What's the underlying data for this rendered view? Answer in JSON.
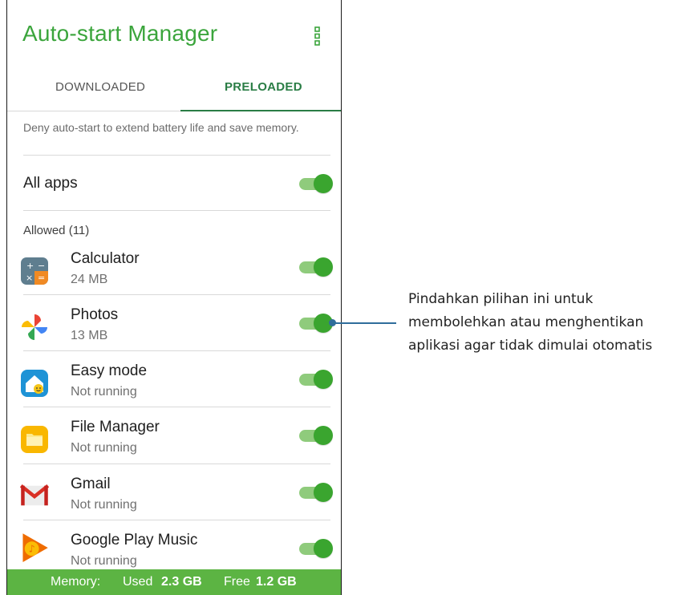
{
  "app": {
    "title": "Auto-start Manager"
  },
  "tabs": [
    {
      "label": "DOWNLOADED",
      "active": false
    },
    {
      "label": "PRELOADED",
      "active": true
    }
  ],
  "description": "Deny auto-start to extend battery life and save memory.",
  "all_apps": {
    "label": "All apps",
    "enabled": true
  },
  "section_header": "Allowed (11)",
  "apps": [
    {
      "name": "Calculator",
      "detail": "24 MB",
      "icon": "calculator-icon",
      "enabled": true
    },
    {
      "name": "Photos",
      "detail": "13 MB",
      "icon": "photos-icon",
      "enabled": true
    },
    {
      "name": "Easy mode",
      "detail": "Not running",
      "icon": "easy-mode-icon",
      "enabled": true
    },
    {
      "name": "File Manager",
      "detail": "Not running",
      "icon": "file-manager-icon",
      "enabled": true
    },
    {
      "name": "Gmail",
      "detail": "Not running",
      "icon": "gmail-icon",
      "enabled": true
    },
    {
      "name": "Google Play Music",
      "detail": "Not running",
      "icon": "play-music-icon",
      "enabled": true
    }
  ],
  "footer": {
    "memory_label": "Memory:",
    "used_label": "Used",
    "used_value": "2.3 GB",
    "free_label": "Free",
    "free_value": "1.2 GB"
  },
  "callout": {
    "line1": "Pindahkan pilihan ini untuk",
    "line2": "membolehkan atau menghentikan",
    "line3": "aplikasi agar tidak dimulai otomatis"
  },
  "colors": {
    "accent": "#3ba53c",
    "tab_active": "#2a7d45",
    "toggle_on": "#3aa52f",
    "footer_bg": "#5cb443",
    "callout": "#2f6d9b"
  }
}
